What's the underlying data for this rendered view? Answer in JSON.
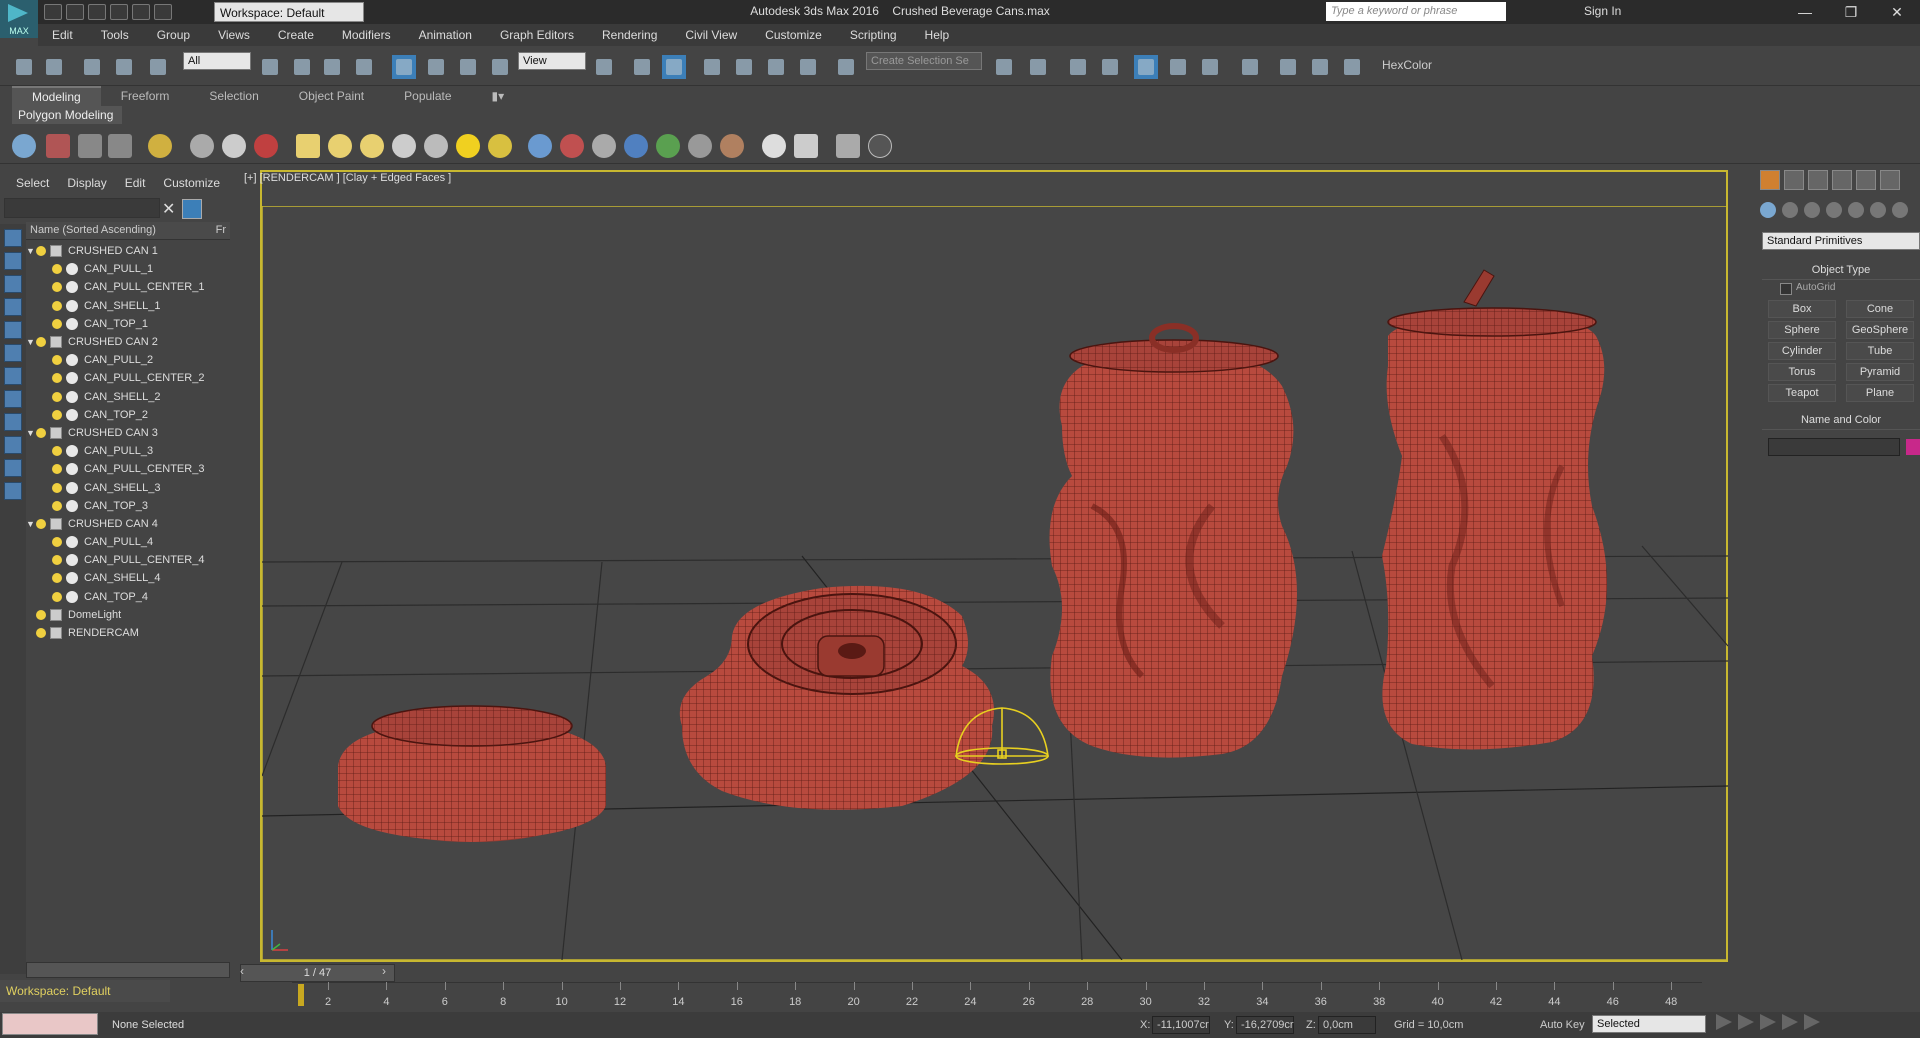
{
  "app": {
    "title": "Autodesk 3ds Max 2016",
    "filename": "Crushed Beverage Cans.max",
    "logo_label": "MAX",
    "workspace": "Workspace: Default",
    "search_placeholder": "Type a keyword or phrase",
    "sign_in": "Sign In"
  },
  "menu": [
    "Edit",
    "Tools",
    "Group",
    "Views",
    "Create",
    "Modifiers",
    "Animation",
    "Graph Editors",
    "Rendering",
    "Civil View",
    "Customize",
    "Scripting",
    "Help"
  ],
  "toolbar": {
    "selection_filter": "All",
    "ref_coord": "View",
    "named_selection": "Create Selection Se",
    "hexcolor_label": "HexColor"
  },
  "ribbon": {
    "tabs": [
      "Modeling",
      "Freeform",
      "Selection",
      "Object Paint",
      "Populate"
    ],
    "active_tab": "Modeling",
    "panel": "Polygon Modeling"
  },
  "explorer": {
    "menu": [
      "Select",
      "Display",
      "Edit",
      "Customize"
    ],
    "column_header": "Name (Sorted Ascending)",
    "column_header_right": "Fr",
    "tree": [
      {
        "label": "CRUSHED CAN 1",
        "level": 0,
        "kind": "group"
      },
      {
        "label": "CAN_PULL_1",
        "level": 1,
        "kind": "obj"
      },
      {
        "label": "CAN_PULL_CENTER_1",
        "level": 1,
        "kind": "obj"
      },
      {
        "label": "CAN_SHELL_1",
        "level": 1,
        "kind": "obj"
      },
      {
        "label": "CAN_TOP_1",
        "level": 1,
        "kind": "obj"
      },
      {
        "label": "CRUSHED CAN 2",
        "level": 0,
        "kind": "group"
      },
      {
        "label": "CAN_PULL_2",
        "level": 1,
        "kind": "obj"
      },
      {
        "label": "CAN_PULL_CENTER_2",
        "level": 1,
        "kind": "obj"
      },
      {
        "label": "CAN_SHELL_2",
        "level": 1,
        "kind": "obj"
      },
      {
        "label": "CAN_TOP_2",
        "level": 1,
        "kind": "obj"
      },
      {
        "label": "CRUSHED CAN 3",
        "level": 0,
        "kind": "group"
      },
      {
        "label": "CAN_PULL_3",
        "level": 1,
        "kind": "obj"
      },
      {
        "label": "CAN_PULL_CENTER_3",
        "level": 1,
        "kind": "obj"
      },
      {
        "label": "CAN_SHELL_3",
        "level": 1,
        "kind": "obj"
      },
      {
        "label": "CAN_TOP_3",
        "level": 1,
        "kind": "obj"
      },
      {
        "label": "CRUSHED CAN 4",
        "level": 0,
        "kind": "group"
      },
      {
        "label": "CAN_PULL_4",
        "level": 1,
        "kind": "obj"
      },
      {
        "label": "CAN_PULL_CENTER_4",
        "level": 1,
        "kind": "obj"
      },
      {
        "label": "CAN_SHELL_4",
        "level": 1,
        "kind": "obj"
      },
      {
        "label": "CAN_TOP_4",
        "level": 1,
        "kind": "obj"
      },
      {
        "label": "DomeLight",
        "level": 0,
        "kind": "light"
      },
      {
        "label": "RENDERCAM",
        "level": 0,
        "kind": "camera"
      }
    ]
  },
  "viewport": {
    "label": "[+] [RENDERCAM ] [Clay + Edged Faces ]",
    "mesh_color": "#b84a3e",
    "border_color": "#c8b830"
  },
  "command_panel": {
    "category": "Standard Primitives",
    "object_type_title": "Object Type",
    "autogrid": "AutoGrid",
    "buttons": [
      "Box",
      "Cone",
      "Sphere",
      "GeoSphere",
      "Cylinder",
      "Tube",
      "Torus",
      "Pyramid",
      "Teapot",
      "Plane"
    ],
    "name_color_title": "Name and Color",
    "object_color": "#c8288a"
  },
  "timeline": {
    "frame_counter": "1 / 47",
    "ticks": [
      "2",
      "4",
      "6",
      "8",
      "10",
      "12",
      "14",
      "16",
      "18",
      "20",
      "22",
      "24",
      "26",
      "28",
      "30",
      "32",
      "34",
      "36",
      "38",
      "40",
      "42",
      "44",
      "46",
      "48"
    ]
  },
  "status": {
    "selection": "None Selected",
    "x_label": "X:",
    "x_value": "-11,1007cr",
    "y_label": "Y:",
    "y_value": "-16,2709cr",
    "z_label": "Z:",
    "z_value": "0,0cm",
    "grid": "Grid = 10,0cm",
    "autokey": "Auto Key",
    "key_mode": "Selected"
  }
}
